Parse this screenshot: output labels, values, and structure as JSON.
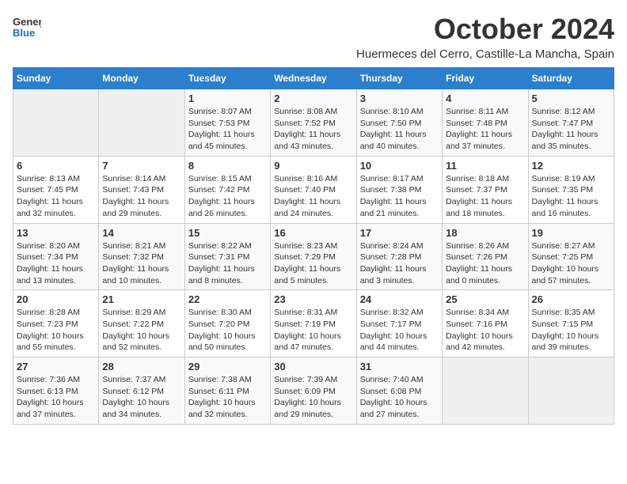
{
  "header": {
    "logo_general": "General",
    "logo_blue": "Blue",
    "month": "October 2024",
    "location": "Huermeces del Cerro, Castille-La Mancha, Spain"
  },
  "weekdays": [
    "Sunday",
    "Monday",
    "Tuesday",
    "Wednesday",
    "Thursday",
    "Friday",
    "Saturday"
  ],
  "weeks": [
    [
      {
        "day": "",
        "info": ""
      },
      {
        "day": "",
        "info": ""
      },
      {
        "day": "1",
        "info": "Sunrise: 8:07 AM\nSunset: 7:53 PM\nDaylight: 11 hours and 45 minutes."
      },
      {
        "day": "2",
        "info": "Sunrise: 8:08 AM\nSunset: 7:52 PM\nDaylight: 11 hours and 43 minutes."
      },
      {
        "day": "3",
        "info": "Sunrise: 8:10 AM\nSunset: 7:50 PM\nDaylight: 11 hours and 40 minutes."
      },
      {
        "day": "4",
        "info": "Sunrise: 8:11 AM\nSunset: 7:48 PM\nDaylight: 11 hours and 37 minutes."
      },
      {
        "day": "5",
        "info": "Sunrise: 8:12 AM\nSunset: 7:47 PM\nDaylight: 11 hours and 35 minutes."
      }
    ],
    [
      {
        "day": "6",
        "info": "Sunrise: 8:13 AM\nSunset: 7:45 PM\nDaylight: 11 hours and 32 minutes."
      },
      {
        "day": "7",
        "info": "Sunrise: 8:14 AM\nSunset: 7:43 PM\nDaylight: 11 hours and 29 minutes."
      },
      {
        "day": "8",
        "info": "Sunrise: 8:15 AM\nSunset: 7:42 PM\nDaylight: 11 hours and 26 minutes."
      },
      {
        "day": "9",
        "info": "Sunrise: 8:16 AM\nSunset: 7:40 PM\nDaylight: 11 hours and 24 minutes."
      },
      {
        "day": "10",
        "info": "Sunrise: 8:17 AM\nSunset: 7:38 PM\nDaylight: 11 hours and 21 minutes."
      },
      {
        "day": "11",
        "info": "Sunrise: 8:18 AM\nSunset: 7:37 PM\nDaylight: 11 hours and 18 minutes."
      },
      {
        "day": "12",
        "info": "Sunrise: 8:19 AM\nSunset: 7:35 PM\nDaylight: 11 hours and 16 minutes."
      }
    ],
    [
      {
        "day": "13",
        "info": "Sunrise: 8:20 AM\nSunset: 7:34 PM\nDaylight: 11 hours and 13 minutes."
      },
      {
        "day": "14",
        "info": "Sunrise: 8:21 AM\nSunset: 7:32 PM\nDaylight: 11 hours and 10 minutes."
      },
      {
        "day": "15",
        "info": "Sunrise: 8:22 AM\nSunset: 7:31 PM\nDaylight: 11 hours and 8 minutes."
      },
      {
        "day": "16",
        "info": "Sunrise: 8:23 AM\nSunset: 7:29 PM\nDaylight: 11 hours and 5 minutes."
      },
      {
        "day": "17",
        "info": "Sunrise: 8:24 AM\nSunset: 7:28 PM\nDaylight: 11 hours and 3 minutes."
      },
      {
        "day": "18",
        "info": "Sunrise: 8:26 AM\nSunset: 7:26 PM\nDaylight: 11 hours and 0 minutes."
      },
      {
        "day": "19",
        "info": "Sunrise: 8:27 AM\nSunset: 7:25 PM\nDaylight: 10 hours and 57 minutes."
      }
    ],
    [
      {
        "day": "20",
        "info": "Sunrise: 8:28 AM\nSunset: 7:23 PM\nDaylight: 10 hours and 55 minutes."
      },
      {
        "day": "21",
        "info": "Sunrise: 8:29 AM\nSunset: 7:22 PM\nDaylight: 10 hours and 52 minutes."
      },
      {
        "day": "22",
        "info": "Sunrise: 8:30 AM\nSunset: 7:20 PM\nDaylight: 10 hours and 50 minutes."
      },
      {
        "day": "23",
        "info": "Sunrise: 8:31 AM\nSunset: 7:19 PM\nDaylight: 10 hours and 47 minutes."
      },
      {
        "day": "24",
        "info": "Sunrise: 8:32 AM\nSunset: 7:17 PM\nDaylight: 10 hours and 44 minutes."
      },
      {
        "day": "25",
        "info": "Sunrise: 8:34 AM\nSunset: 7:16 PM\nDaylight: 10 hours and 42 minutes."
      },
      {
        "day": "26",
        "info": "Sunrise: 8:35 AM\nSunset: 7:15 PM\nDaylight: 10 hours and 39 minutes."
      }
    ],
    [
      {
        "day": "27",
        "info": "Sunrise: 7:36 AM\nSunset: 6:13 PM\nDaylight: 10 hours and 37 minutes."
      },
      {
        "day": "28",
        "info": "Sunrise: 7:37 AM\nSunset: 6:12 PM\nDaylight: 10 hours and 34 minutes."
      },
      {
        "day": "29",
        "info": "Sunrise: 7:38 AM\nSunset: 6:11 PM\nDaylight: 10 hours and 32 minutes."
      },
      {
        "day": "30",
        "info": "Sunrise: 7:39 AM\nSunset: 6:09 PM\nDaylight: 10 hours and 29 minutes."
      },
      {
        "day": "31",
        "info": "Sunrise: 7:40 AM\nSunset: 6:08 PM\nDaylight: 10 hours and 27 minutes."
      },
      {
        "day": "",
        "info": ""
      },
      {
        "day": "",
        "info": ""
      }
    ]
  ]
}
